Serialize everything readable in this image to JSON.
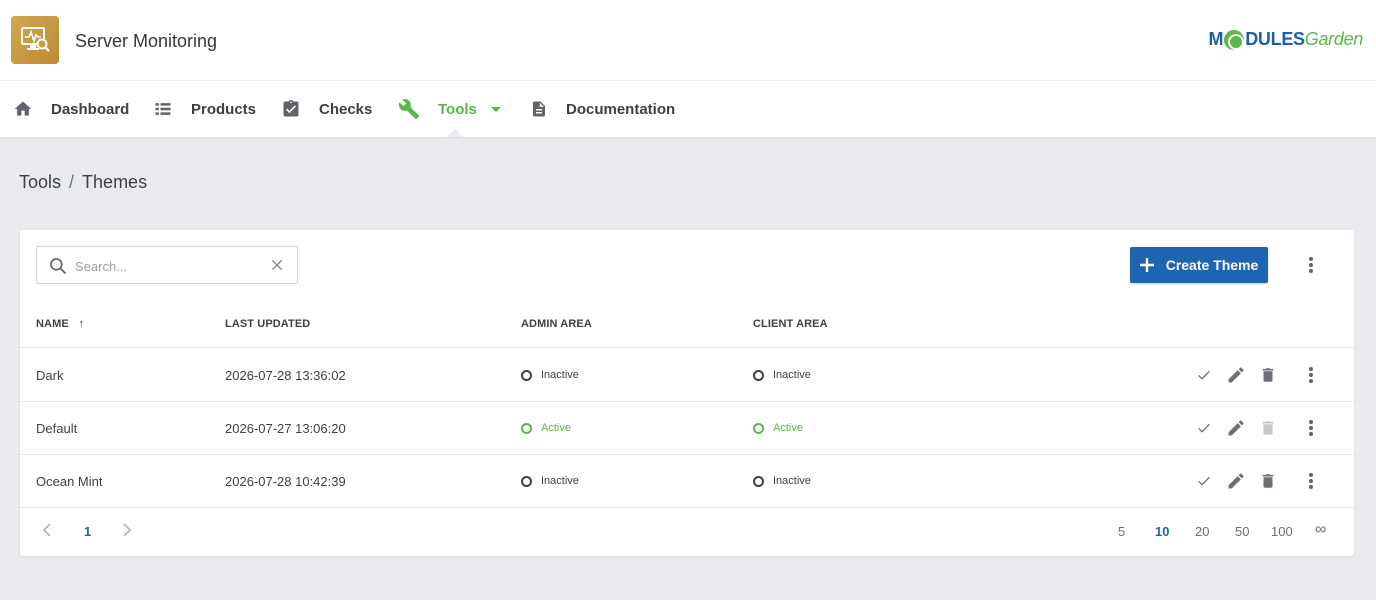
{
  "header": {
    "app_title": "Server Monitoring",
    "brand_left": "M",
    "brand_mid": "DULES",
    "brand_right": "Garden"
  },
  "nav": {
    "items": [
      {
        "label": "Dashboard",
        "icon": "home-icon"
      },
      {
        "label": "Products",
        "icon": "list-icon"
      },
      {
        "label": "Checks",
        "icon": "clipboard-check-icon"
      },
      {
        "label": "Tools",
        "icon": "wrench-icon",
        "active": true
      },
      {
        "label": "Documentation",
        "icon": "document-icon"
      }
    ]
  },
  "breadcrumb": {
    "parent": "Tools",
    "separator": "/",
    "current": "Themes"
  },
  "toolbar": {
    "search_placeholder": "Search...",
    "search_value": "",
    "create_label": "Create Theme"
  },
  "table": {
    "headers": {
      "name": "NAME",
      "sort_indicator": "↑",
      "last_updated": "LAST UPDATED",
      "admin_area": "ADMIN AREA",
      "client_area": "CLIENT AREA"
    },
    "rows": [
      {
        "name": "Dark",
        "last_updated": "2026-07-28 13:36:02",
        "admin_area": "Inactive",
        "client_area": "Inactive"
      },
      {
        "name": "Default",
        "last_updated": "2026-07-27 13:06:20",
        "admin_area": "Active",
        "client_area": "Active"
      },
      {
        "name": "Ocean Mint",
        "last_updated": "2026-07-28 10:42:39",
        "admin_area": "Inactive",
        "client_area": "Inactive"
      }
    ]
  },
  "pagination": {
    "current_page": "1",
    "page_sizes": [
      "5",
      "10",
      "20",
      "50",
      "100",
      "∞"
    ],
    "selected_page_size": "10"
  },
  "colors": {
    "accent_green": "#58b947",
    "primary_blue": "#1f64b0",
    "background": "#e9eaee"
  }
}
